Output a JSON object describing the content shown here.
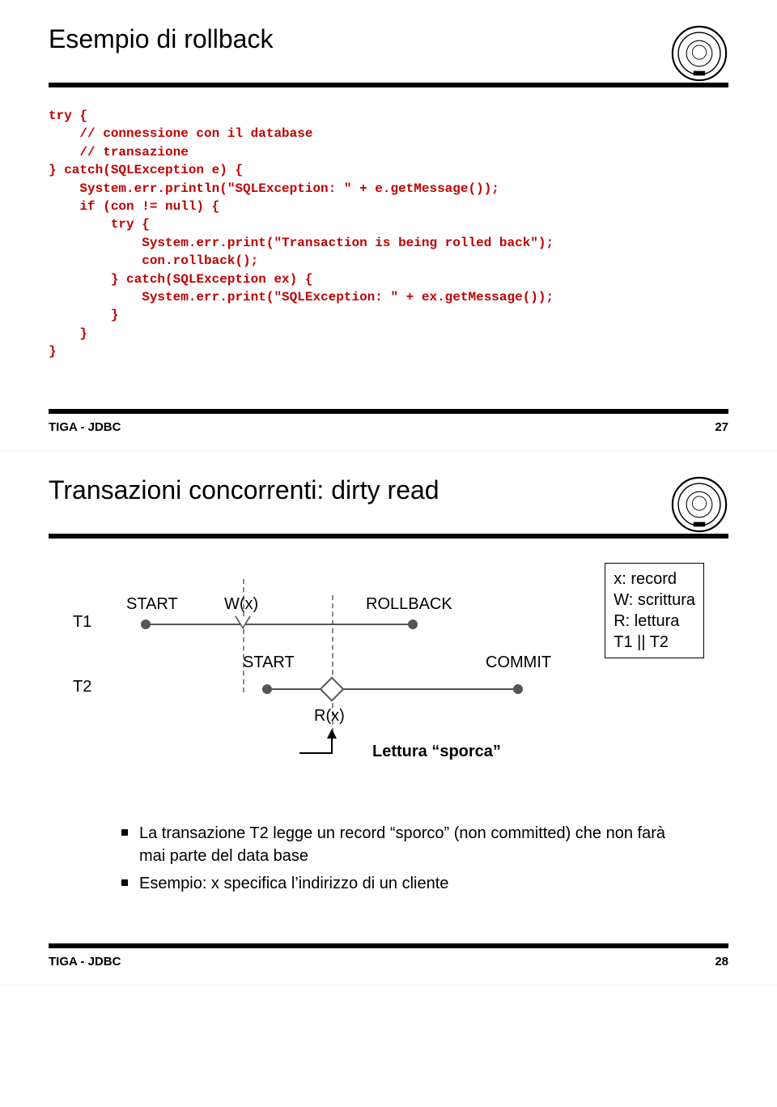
{
  "slide1": {
    "title": "Esempio di rollback",
    "code": "try {\n    // connessione con il database\n    // transazione\n} catch(SQLException e) {\n    System.err.println(\"SQLException: \" + e.getMessage());\n    if (con != null) {\n        try {\n            System.err.print(\"Transaction is being rolled back\");\n            con.rollback();\n        } catch(SQLException ex) {\n            System.err.print(\"SQLException: \" + ex.getMessage());\n        }\n    }\n}",
    "footer_label": "TIGA - JDBC",
    "page": "27"
  },
  "slide2": {
    "title": "Transazioni concorrenti: dirty read",
    "legend": {
      "l1": "x: record",
      "l2": "W: scrittura",
      "l3": "R: lettura",
      "l4": "T1 || T2"
    },
    "labels": {
      "t1": "T1",
      "t2": "T2",
      "start1": "START",
      "start2": "START",
      "wx": "W(x)",
      "rx": "R(x)",
      "rollback": "ROLLBACK",
      "commit": "COMMIT",
      "lettura": "Lettura “sporca”"
    },
    "bullets": {
      "b1": "La transazione T2 legge un record “sporco” (non committed) che non farà mai parte del data base",
      "b2": "Esempio: x specifica l’indirizzo di un cliente"
    },
    "footer_label": "TIGA - JDBC",
    "page": "28"
  }
}
